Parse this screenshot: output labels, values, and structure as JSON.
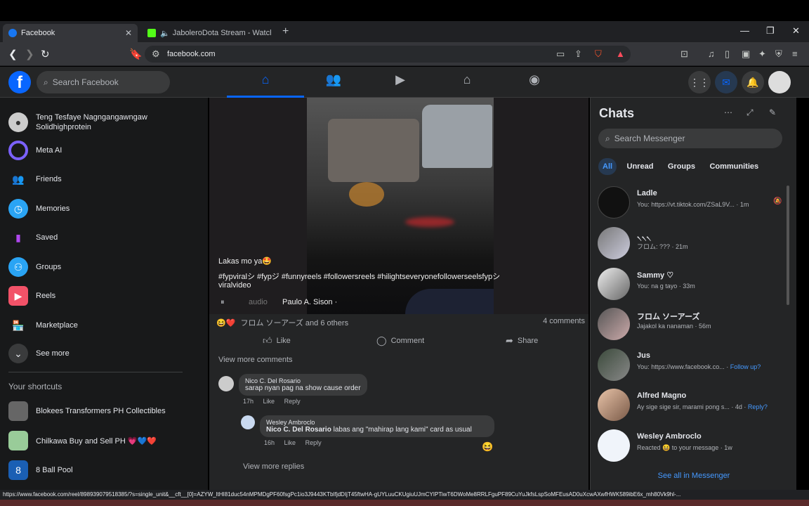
{
  "browser": {
    "tabs": [
      {
        "title": "Facebook",
        "favicon_color": "#1877f2",
        "active": true
      },
      {
        "title": "JaboleroDota Stream - Watch Liv",
        "favicon_color": "#53fc18",
        "active": false
      }
    ],
    "new_tab": "+",
    "url": "facebook.com",
    "status_url": "https://www.facebook.com/reel/898939079518385/?s=single_unit&__cft__[0]=AZYW_ltHI81duc54nMPMDgPF60fsgPc1io3J9443KTbIfjdDIjT45ftwHA-gUYLuuCKUgiuUJmCYIPTiwT6DWoMe8RRLFguPF89CuYuJkfsLspSoMFEusAD0uXcwAXwfHWK589ibE6x_mh80Vk9hl-..."
  },
  "fb": {
    "search_placeholder": "Search Facebook",
    "brand_color": "#0866ff"
  },
  "left_nav": {
    "items": [
      {
        "label": "Teng Tesfaye Nagngangawngaw Solidhighprotein",
        "icon": "avatar"
      },
      {
        "label": "Meta AI",
        "icon": "meta-ai-icon"
      },
      {
        "label": "Friends",
        "icon": "friends-icon"
      },
      {
        "label": "Memories",
        "icon": "memories-icon"
      },
      {
        "label": "Saved",
        "icon": "saved-icon"
      },
      {
        "label": "Groups",
        "icon": "groups-icon"
      },
      {
        "label": "Reels",
        "icon": "reels-icon"
      },
      {
        "label": "Marketplace",
        "icon": "marketplace-icon"
      },
      {
        "label": "See more",
        "icon": "chevron-down-icon"
      }
    ],
    "shortcuts_heading": "Your shortcuts",
    "shortcuts": [
      {
        "label": "Blokees Transformers PH Collectibles"
      },
      {
        "label": "Chilkawa Buy and Sell PH 💗💙❤️"
      },
      {
        "label": "8 Ball Pool"
      }
    ]
  },
  "post": {
    "caption_line1": "Lakas mo ya🤩",
    "caption_line2": "#fypviralシ #fypジ #funnyreels #followersreels #hilightseveryonefollowerseelsfypシ",
    "caption_line3": "viralvideo",
    "audio": "audio",
    "author": "Paulo A. Sison ·",
    "reactions_text": "フロム ソーアーズ and 6 others",
    "comments_count": "4 comments",
    "like": "Like",
    "comment": "Comment",
    "share": "Share",
    "view_more_comments": "View more comments",
    "comments": [
      {
        "name": "Nico C. Del Rosario",
        "text": "sarap nyan pag na show cause order",
        "time": "17h",
        "like": "Like",
        "reply": "Reply"
      },
      {
        "name": "Wesley Ambroclo",
        "mention": "Nico C. Del Rosario",
        "text": "labas ang \"mahirap lang kami\" card as usual",
        "time": "16h",
        "like": "Like",
        "reply": "Reply"
      }
    ],
    "view_more_replies": "View more replies"
  },
  "chats": {
    "title": "Chats",
    "search_placeholder": "Search Messenger",
    "filters": [
      "All",
      "Unread",
      "Groups",
      "Communities"
    ],
    "items": [
      {
        "name": "Ladle",
        "preview": "You: https://vt.tiktok.com/ZSaL9V... · 1m",
        "highlight": ""
      },
      {
        "name": "৲৲৲",
        "preview": "フロム: ??? · 21m",
        "highlight": ""
      },
      {
        "name": "Sammy ♡",
        "preview": "You: na g tayo · 33m",
        "highlight": ""
      },
      {
        "name": "フロム ソーアーズ",
        "preview": "Jajakol ka nanaman · 56m",
        "highlight": ""
      },
      {
        "name": "Jus",
        "preview": "You: https://www.facebook.co... · ",
        "highlight": "Follow up?"
      },
      {
        "name": "Alfred Magno",
        "preview": "Ay sige sige sir, marami pong s... · 4d · ",
        "highlight": "Reply?"
      },
      {
        "name": "Wesley Ambroclo",
        "preview": "Reacted 😆 to your message · 1w",
        "highlight": ""
      }
    ],
    "see_all": "See all in Messenger"
  }
}
